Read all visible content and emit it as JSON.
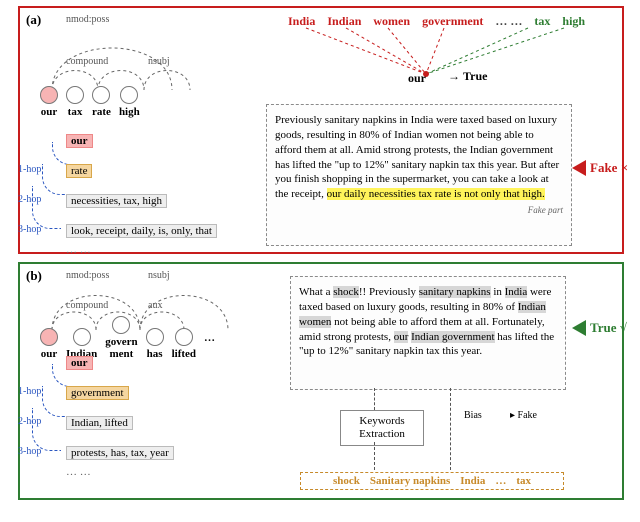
{
  "panel_a": {
    "tag": "(a)",
    "dep_words": [
      "our",
      "tax",
      "rate",
      "high"
    ],
    "dep_labels": {
      "nmodposs": "nmod:poss",
      "compound": "compound",
      "nsubj": "nsubj"
    },
    "hops": {
      "seed": "our",
      "h1_label": "1-hop",
      "h1": "rate",
      "h2_label": "2-hop",
      "h2": "necessities, tax, high",
      "h3_label": "3-hop",
      "h3": "look, receipt, daily, is, only, that",
      "dots": "… …"
    },
    "fan": {
      "words_red": [
        "India",
        "Indian",
        "women",
        "government"
      ],
      "ellipsis": "…  …",
      "words_green": [
        "tax",
        "high"
      ],
      "focus": "our",
      "arrow": "→",
      "result": "True"
    },
    "paragraph": "Previously sanitary napkins in India were taxed based on luxury goods, resulting in 80% of Indian women not being able to afford them at all. Amid strong protests, the Indian government has lifted the \"up to 12%\" sanitary napkin tax this year. But after you finish shopping in the supermarket, you can take a look at the receipt,",
    "paragraph_hl": "our daily necessities tax rate is not only that high.",
    "fake_part_label": "Fake part",
    "side_label": "Fake ×"
  },
  "panel_b": {
    "tag": "(b)",
    "dep_words": [
      "our",
      "Indian",
      "govern\nment",
      "has",
      "lifted"
    ],
    "dep_labels": {
      "nmodposs": "nmod:poss",
      "compound": "compound",
      "aux": "aux",
      "nsubj": "nsubj"
    },
    "hops": {
      "seed": "our",
      "h1_label": "1-hop",
      "h1": "government",
      "h2_label": "2-hop",
      "h2": "Indian, lifted",
      "h3_label": "3-hop",
      "h3": "protests, has, tax, year",
      "dots": "… …"
    },
    "paragraph_pre": "What a ",
    "shock": "shock",
    "paragraph_mid": "!! Previously ",
    "kw1": "sanitary napkins",
    "paragraph_mid2": " in ",
    "kw2": "India",
    "paragraph_mid3": " were taxed based on luxury goods, resulting in 80% of ",
    "kw3": "Indian women",
    "paragraph_mid4": " not being able to afford them at all. Fortunately, amid strong protests, ",
    "kw4": "our",
    "paragraph_mid5": " ",
    "kw5": "Indian government",
    "paragraph_end": " has lifted the \"up to 12%\" sanitary napkin tax this year.",
    "side_label": "True √",
    "kw_box": "Keywords Extraction",
    "bias_label": "Bias",
    "fake_pred": "Fake",
    "kw_out": [
      "shock",
      "Sanitary napkins",
      "India",
      "…",
      "tax"
    ]
  },
  "caption": "",
  "chart_data": {
    "type": "diagram",
    "description": "Two-panel illustration contrasting dependency-hop expansion and keyword-bias pipelines for fake-news detection; no numeric axes.",
    "panels": [
      {
        "id": "a",
        "border": "#c71d1d",
        "verdict_side": "Fake ×",
        "attention_fan_to": "our",
        "attention_result": "True",
        "dep_chain": [
          "our",
          "tax",
          "rate",
          "high"
        ],
        "hops": {
          "1": "rate",
          "2": [
            "necessities",
            "tax",
            "high"
          ],
          "3": [
            "look",
            "receipt",
            "daily",
            "is",
            "only",
            "that"
          ]
        }
      },
      {
        "id": "b",
        "border": "#2e7d32",
        "verdict_side": "True √",
        "dep_chain": [
          "our",
          "Indian",
          "government",
          "has",
          "lifted"
        ],
        "hops": {
          "1": "government",
          "2": [
            "Indian",
            "lifted"
          ],
          "3": [
            "protests",
            "has",
            "tax",
            "year"
          ]
        },
        "keyword_extraction_output": [
          "shock",
          "Sanitary napkins",
          "India",
          "tax"
        ],
        "bias_prediction": "Fake"
      }
    ]
  }
}
